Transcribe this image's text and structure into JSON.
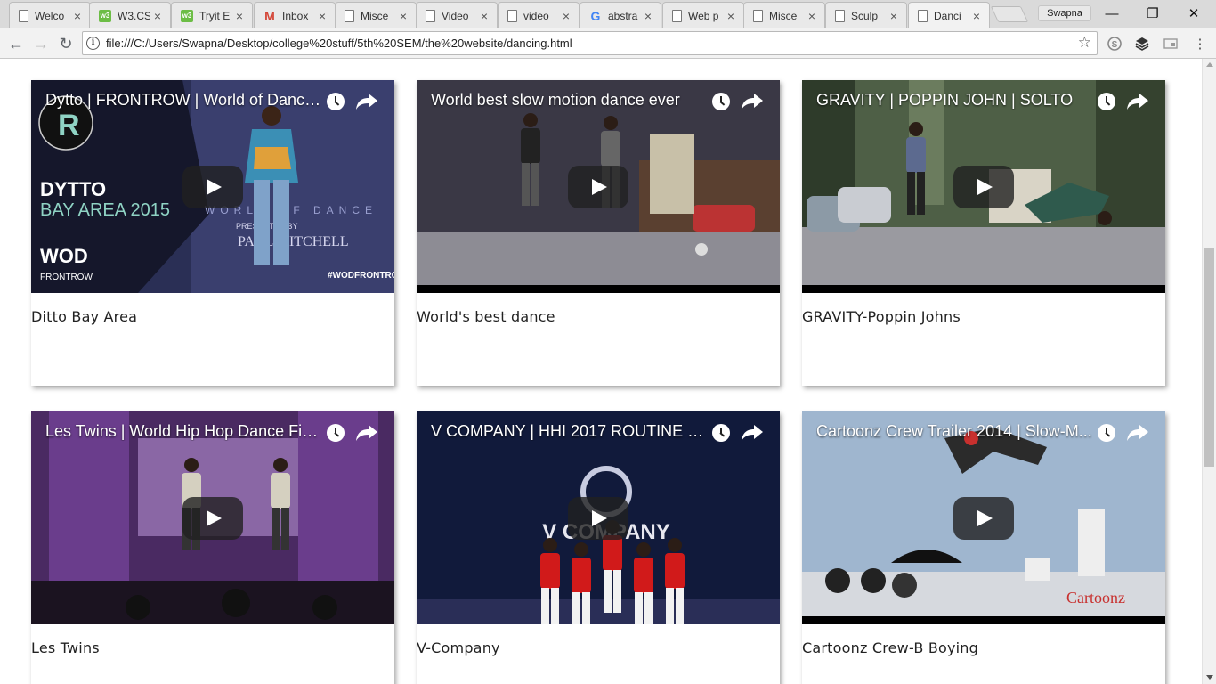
{
  "browser": {
    "tabs": [
      {
        "label": "Welco",
        "icon": "document-icon"
      },
      {
        "label": "W3.CS",
        "icon": "w3schools-icon"
      },
      {
        "label": "Tryit E",
        "icon": "w3schools-icon"
      },
      {
        "label": "Inbox",
        "icon": "gmail-icon"
      },
      {
        "label": "Misce",
        "icon": "document-icon"
      },
      {
        "label": "Video",
        "icon": "document-icon"
      },
      {
        "label": "video",
        "icon": "document-icon"
      },
      {
        "label": "abstra",
        "icon": "google-icon"
      },
      {
        "label": "Web p",
        "icon": "document-icon"
      },
      {
        "label": "Misce",
        "icon": "document-icon"
      },
      {
        "label": "Sculp",
        "icon": "document-icon"
      },
      {
        "label": "Danci",
        "icon": "document-icon",
        "active": true
      }
    ],
    "profile_name": "Swapna",
    "url": "file:///C:/Users/Swapna/Desktop/college%20stuff/5th%20SEM/the%20website/dancing.html"
  },
  "videos": [
    {
      "title": "Dytto | FRONTROW | World of Dance ...",
      "caption": "Ditto Bay Area",
      "overlay": [
        "DYTTO",
        "BAY AREA 2015",
        "FRONTROW",
        "#WODFRONTROW",
        "WORLD OF DANCE",
        "PRESENTED BY",
        "PAUL MITCHELL"
      ],
      "colors": {
        "bg": "#2a2f55",
        "accent": "#8fd3c4"
      }
    },
    {
      "title": "World best slow motion dance ever",
      "caption": "World's best dance",
      "overlay": [],
      "colors": {
        "bg": "#3b3a40",
        "accent": "#b33"
      }
    },
    {
      "title": "GRAVITY | POPPIN JOHN | SOLTO",
      "caption": "GRAVITY-Poppin Johns",
      "overlay": [],
      "colors": {
        "bg": "#5d6b57",
        "accent": "#8c9aa6"
      }
    },
    {
      "title": "Les Twins | World Hip Hop Dance Fin...",
      "caption": "Les Twins",
      "overlay": [],
      "colors": {
        "bg": "#4a2a62",
        "accent": "#c9a3e8"
      }
    },
    {
      "title": "V COMPANY | HHI 2017 ROUTINE | T...",
      "caption": "V-Company",
      "overlay": [
        "V COMPANY"
      ],
      "colors": {
        "bg": "#111a3b",
        "accent": "#d11a1a"
      }
    },
    {
      "title": "Cartoonz Crew Trailer 2014 | Slow-M...",
      "caption": "Cartoonz Crew-B Boying",
      "overlay": [
        "Cartoonz"
      ],
      "colors": {
        "bg": "#9fb6cf",
        "accent": "#c8302e"
      }
    }
  ]
}
